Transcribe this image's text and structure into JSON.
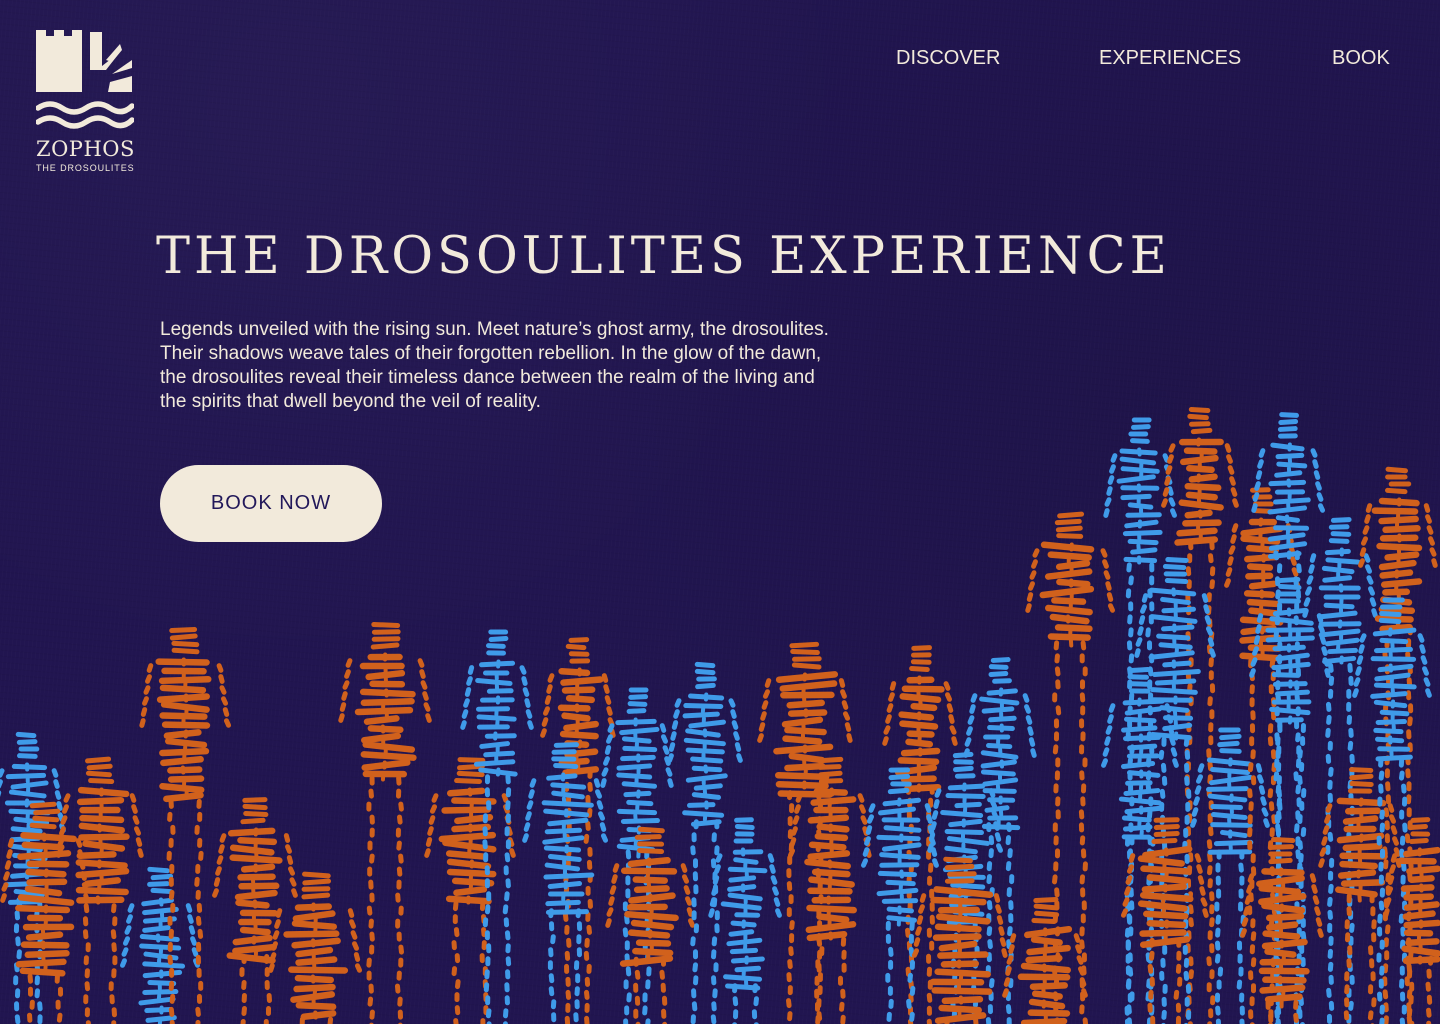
{
  "brand": {
    "name": "ZOPHOS",
    "tagline": "THE DROSOULITES",
    "logo_icon": "castle-sun-waves-icon"
  },
  "nav": {
    "items": [
      {
        "label": "DISCOVER"
      },
      {
        "label": "EXPERIENCES"
      },
      {
        "label": "BOOK"
      }
    ]
  },
  "hero": {
    "title": "THE DROSOULITES EXPERIENCE",
    "description": "Legends unveiled with the rising sun. Meet nature’s ghost army, the drosoulites. Their shadows weave tales of their forgotten rebellion. In the glow of the dawn, the drosoulites reveal their timeless dance between the realm of the living and the spirits that dwell beyond the veil of reality.",
    "cta_label": "BOOK NOW"
  },
  "colors": {
    "background": "#211550",
    "cream": "#f2eadb",
    "orange": "#d1611c",
    "blue": "#3f9be9",
    "button_text": "#22185a"
  },
  "illustration": {
    "name": "drosoulites-ghost-army-illustration"
  }
}
